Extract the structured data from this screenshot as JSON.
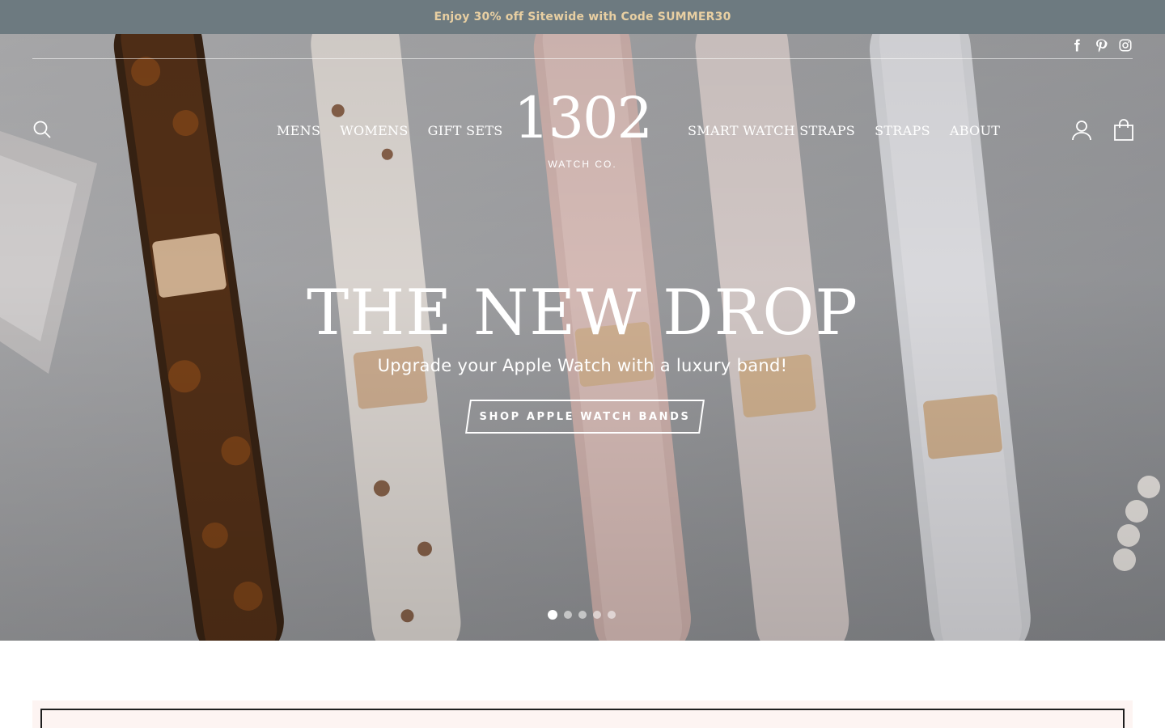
{
  "announcement": {
    "text": "Enjoy 30% off Sitewide with Code SUMMER30"
  },
  "socials": [
    {
      "name": "Facebook",
      "icon": "facebook-icon"
    },
    {
      "name": "Pinterest",
      "icon": "pinterest-icon"
    },
    {
      "name": "Instagram",
      "icon": "instagram-icon"
    }
  ],
  "header": {
    "logo_number": "1302",
    "logo_sub": "WATCH CO.",
    "nav_left": [
      {
        "label": "MENS"
      },
      {
        "label": "WOMENS"
      },
      {
        "label": "GIFT SETS"
      }
    ],
    "nav_right": [
      {
        "label": "SMART WATCH STRAPS"
      },
      {
        "label": "STRAPS"
      },
      {
        "label": "ABOUT"
      }
    ],
    "icons": {
      "search": "search-icon",
      "account": "account-icon",
      "cart": "cart-icon"
    }
  },
  "hero": {
    "title": "THE NEW DROP",
    "subtitle": "Upgrade your Apple Watch with a luxury band!",
    "cta": "SHOP APPLE WATCH BANDS",
    "slides_total": 5,
    "active_slide": 1
  },
  "colors": {
    "announcement_bg": "#6d7a80",
    "announcement_text": "#e8cfa2",
    "promo_bg": "#fdf4f2"
  }
}
